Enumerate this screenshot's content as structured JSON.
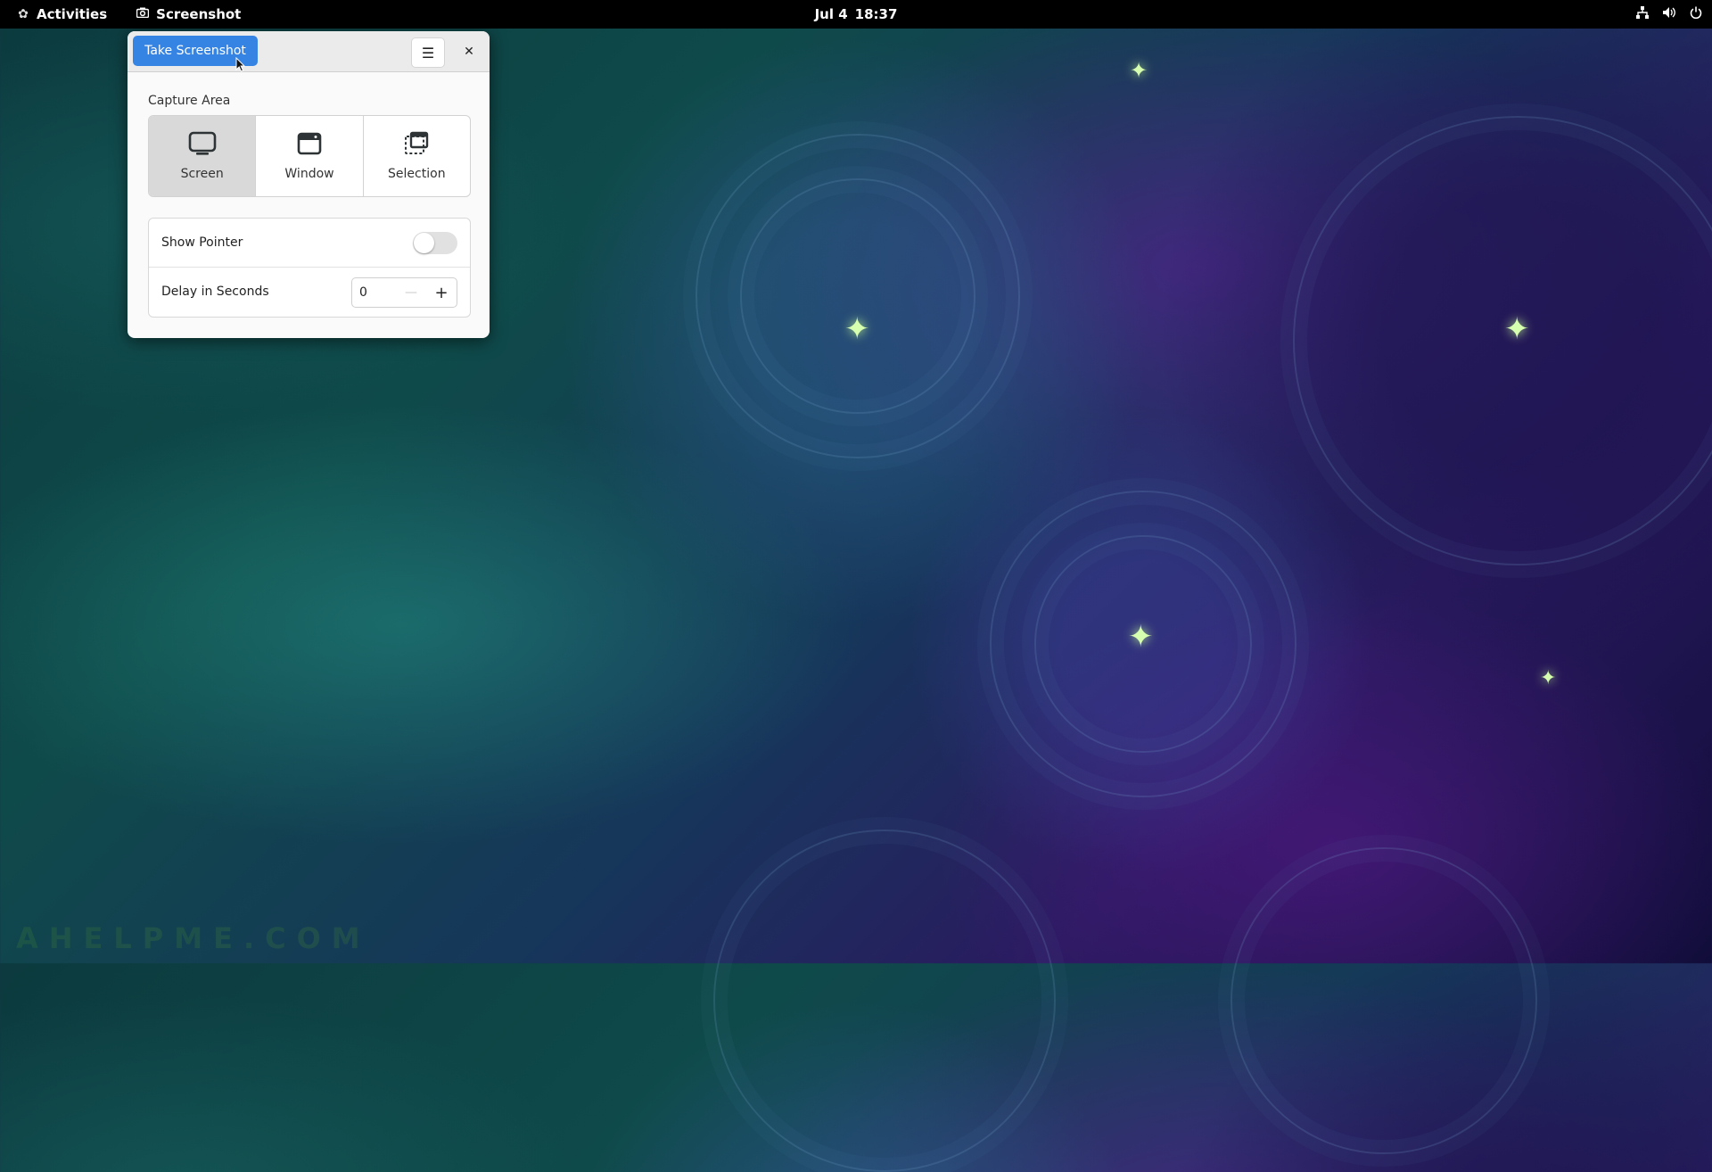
{
  "topbar": {
    "activities": "Activities",
    "app_name": "Screenshot",
    "date": "Jul 4",
    "time": "18:37"
  },
  "dialog": {
    "take_button": "Take Screenshot",
    "capture_area_label": "Capture Area",
    "capture_options": [
      {
        "label": "Screen",
        "icon": "monitor-icon",
        "selected": true
      },
      {
        "label": "Window",
        "icon": "window-icon",
        "selected": false
      },
      {
        "label": "Selection",
        "icon": "selection-icon",
        "selected": false
      }
    ],
    "show_pointer_label": "Show Pointer",
    "show_pointer_on": false,
    "delay_label": "Delay in Seconds",
    "delay_value": "0"
  },
  "watermark": "AHELPME.COM",
  "colors": {
    "accent": "#3584e4",
    "topbar": "#000000",
    "dialog_bg": "#fafafa"
  }
}
